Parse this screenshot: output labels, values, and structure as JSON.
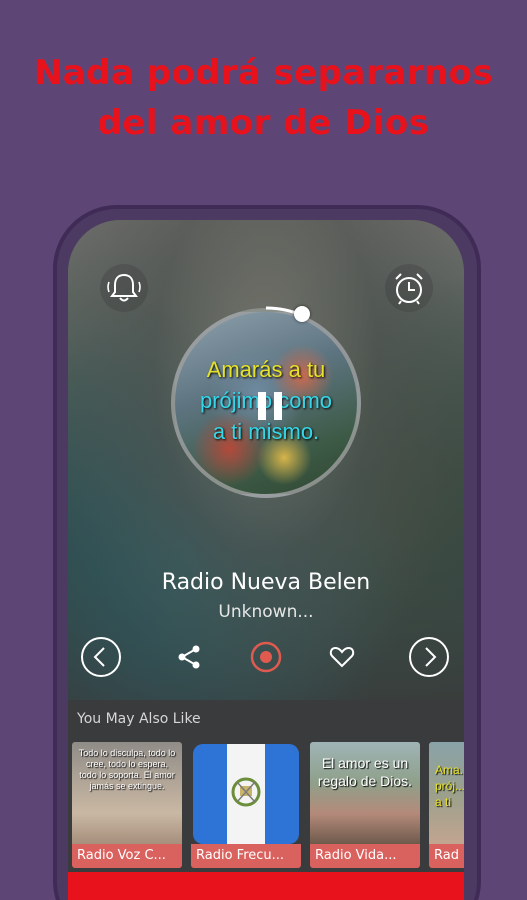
{
  "promo": {
    "line1": "Nada podrá separarnos",
    "line2": "del amor de Dios"
  },
  "player": {
    "top_left_icon": "bell-ring-icon",
    "top_right_icon": "alarm-clock-icon",
    "art_text": {
      "line1": "Amarás a tu",
      "line2": "prójimo como",
      "line3": "a ti mismo."
    },
    "play_state": "pause-icon",
    "progress": 0.08,
    "station_name": "Radio Nueva Belen",
    "station_subtitle": "Unknown...",
    "controls": {
      "prev_icon": "chevron-left-circle-icon",
      "share_icon": "share-icon",
      "record_icon": "record-icon",
      "favorite_icon": "heart-icon",
      "next_icon": "chevron-right-circle-icon"
    },
    "record_color": "#e05a50"
  },
  "suggestions": {
    "title": "You May Also Like",
    "items": [
      {
        "label": "Radio Voz C...",
        "caption": "Todo lo disculpa, todo lo cree, todo lo espera, todo lo soporta. El amor jamás se extingue."
      },
      {
        "label": "Radio Frecu...",
        "caption": ""
      },
      {
        "label": "Radio Vida...",
        "caption": "El amor es un regalo de Dios."
      },
      {
        "label": "Rad",
        "caption": "Ama... prój... a ti"
      }
    ]
  },
  "colors": {
    "background": "#5d4676",
    "promo_text": "#e8121c",
    "card_label_bg": "#d9625f",
    "bottom_bar": "#e8121c"
  }
}
